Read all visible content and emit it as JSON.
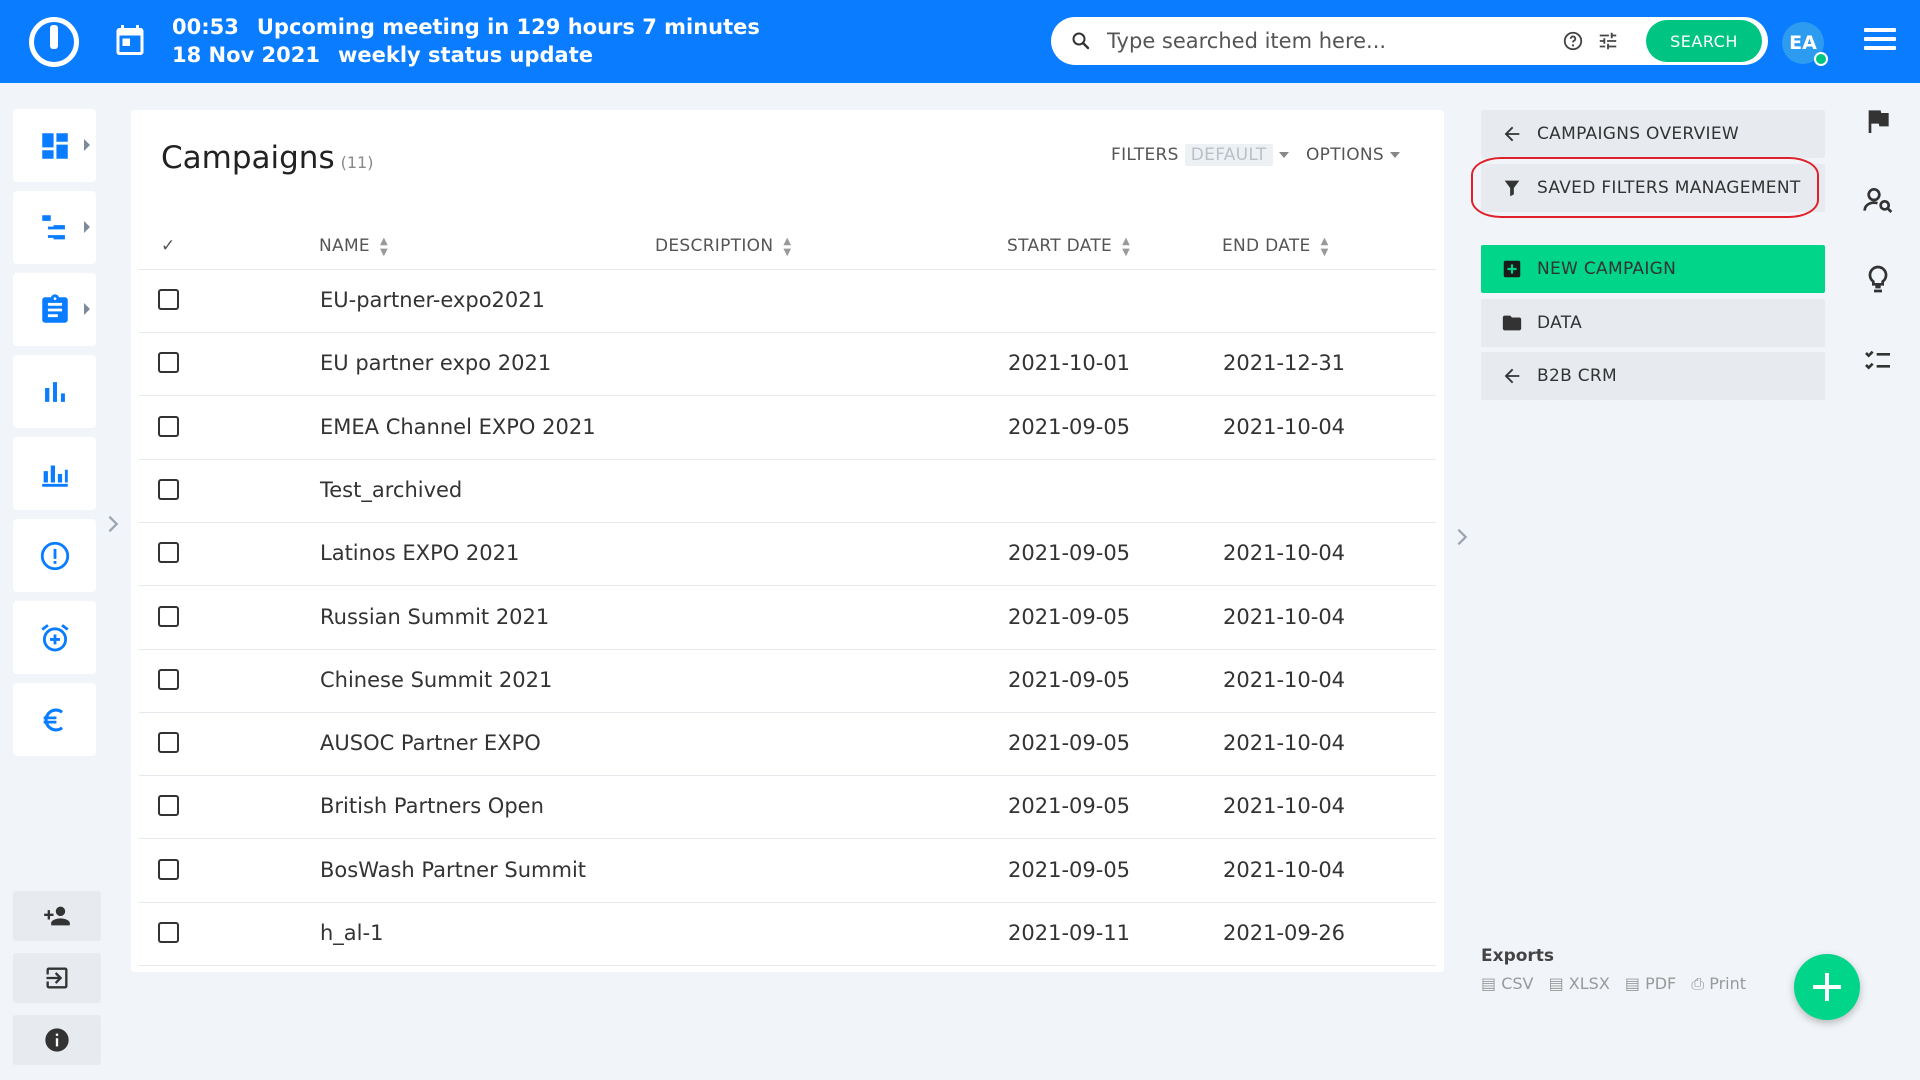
{
  "header": {
    "meeting_time": "00:53",
    "meeting_countdown": "Upcoming meeting in 129 hours 7 minutes",
    "meeting_date": "18 Nov 2021",
    "meeting_title": "weekly status update",
    "search_placeholder": "Type searched item here...",
    "search_button": "SEARCH",
    "avatar_initials": "EA"
  },
  "main": {
    "title": "Campaigns",
    "count": "(11)",
    "filters_label": "FILTERS",
    "filters_value": "DEFAULT",
    "options_label": "OPTIONS",
    "columns": {
      "check": "✓",
      "name": "NAME",
      "description": "DESCRIPTION",
      "start_date": "START DATE",
      "end_date": "END DATE"
    },
    "rows": [
      {
        "name": "EU-partner-expo2021",
        "description": "",
        "start": "",
        "end": ""
      },
      {
        "name": "EU partner expo 2021",
        "description": "",
        "start": "2021-10-01",
        "end": "2021-12-31"
      },
      {
        "name": "EMEA Channel EXPO 2021",
        "description": "",
        "start": "2021-09-05",
        "end": "2021-10-04"
      },
      {
        "name": "Test_archived",
        "description": "",
        "start": "",
        "end": ""
      },
      {
        "name": "Latinos EXPO 2021",
        "description": "",
        "start": "2021-09-05",
        "end": "2021-10-04"
      },
      {
        "name": "Russian Summit 2021",
        "description": "",
        "start": "2021-09-05",
        "end": "2021-10-04"
      },
      {
        "name": "Chinese Summit 2021",
        "description": "",
        "start": "2021-09-05",
        "end": "2021-10-04"
      },
      {
        "name": "AUSOC Partner EXPO",
        "description": "",
        "start": "2021-09-05",
        "end": "2021-10-04"
      },
      {
        "name": "British Partners Open",
        "description": "",
        "start": "2021-09-05",
        "end": "2021-10-04"
      },
      {
        "name": "BosWash Partner Summit",
        "description": "",
        "start": "2021-09-05",
        "end": "2021-10-04"
      },
      {
        "name": "h_al-1",
        "description": "",
        "start": "2021-09-11",
        "end": "2021-09-26"
      }
    ]
  },
  "right": {
    "campaigns_overview": "CAMPAIGNS OVERVIEW",
    "saved_filters": "SAVED FILTERS MANAGEMENT",
    "new_campaign": "NEW CAMPAIGN",
    "data": "DATA",
    "b2b_crm": "B2B CRM",
    "exports_title": "Exports",
    "exports": [
      "CSV",
      "XLSX",
      "PDF",
      "Print"
    ]
  },
  "colors": {
    "brand": "#0a7cff",
    "accent_green": "#00d589",
    "highlight": "#e0212b"
  }
}
